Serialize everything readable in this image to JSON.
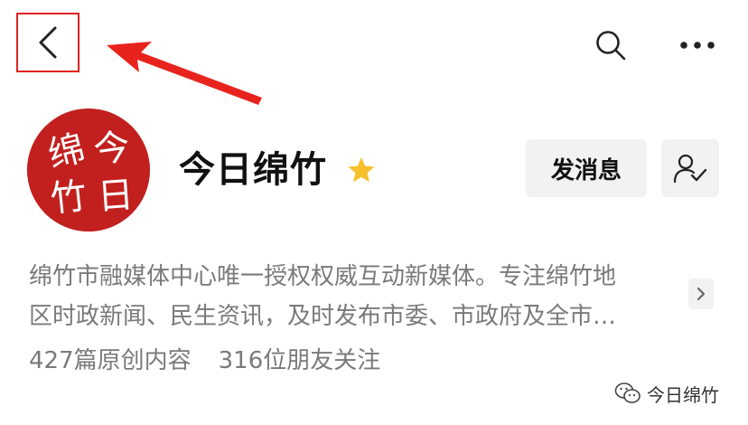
{
  "header": {
    "back_icon": "chevron-left-icon",
    "search_icon": "search-icon",
    "more_icon": "more-horizontal-icon",
    "highlight_color": "#e0221f"
  },
  "profile": {
    "avatar_text": [
      "绵",
      "今",
      "竹",
      "日"
    ],
    "avatar_color": "#c2201f",
    "name": "今日绵竹",
    "verified_icon": "star-icon",
    "verified_color": "#f7c12d",
    "message_button": "发消息",
    "follow_icon": "user-follow-icon",
    "description_line1": "绵竹市融媒体中心唯一授权权威互动新媒体。专注绵竹地",
    "description_line2": "区时政新闻、民生资讯，及时发布市委、市政府及全市…",
    "expand_icon": "chevron-right-icon",
    "original_count": "427篇原创内容",
    "followers": "316位朋友关注"
  },
  "watermark": {
    "icon": "wechat-icon",
    "text": "今日绵竹"
  }
}
